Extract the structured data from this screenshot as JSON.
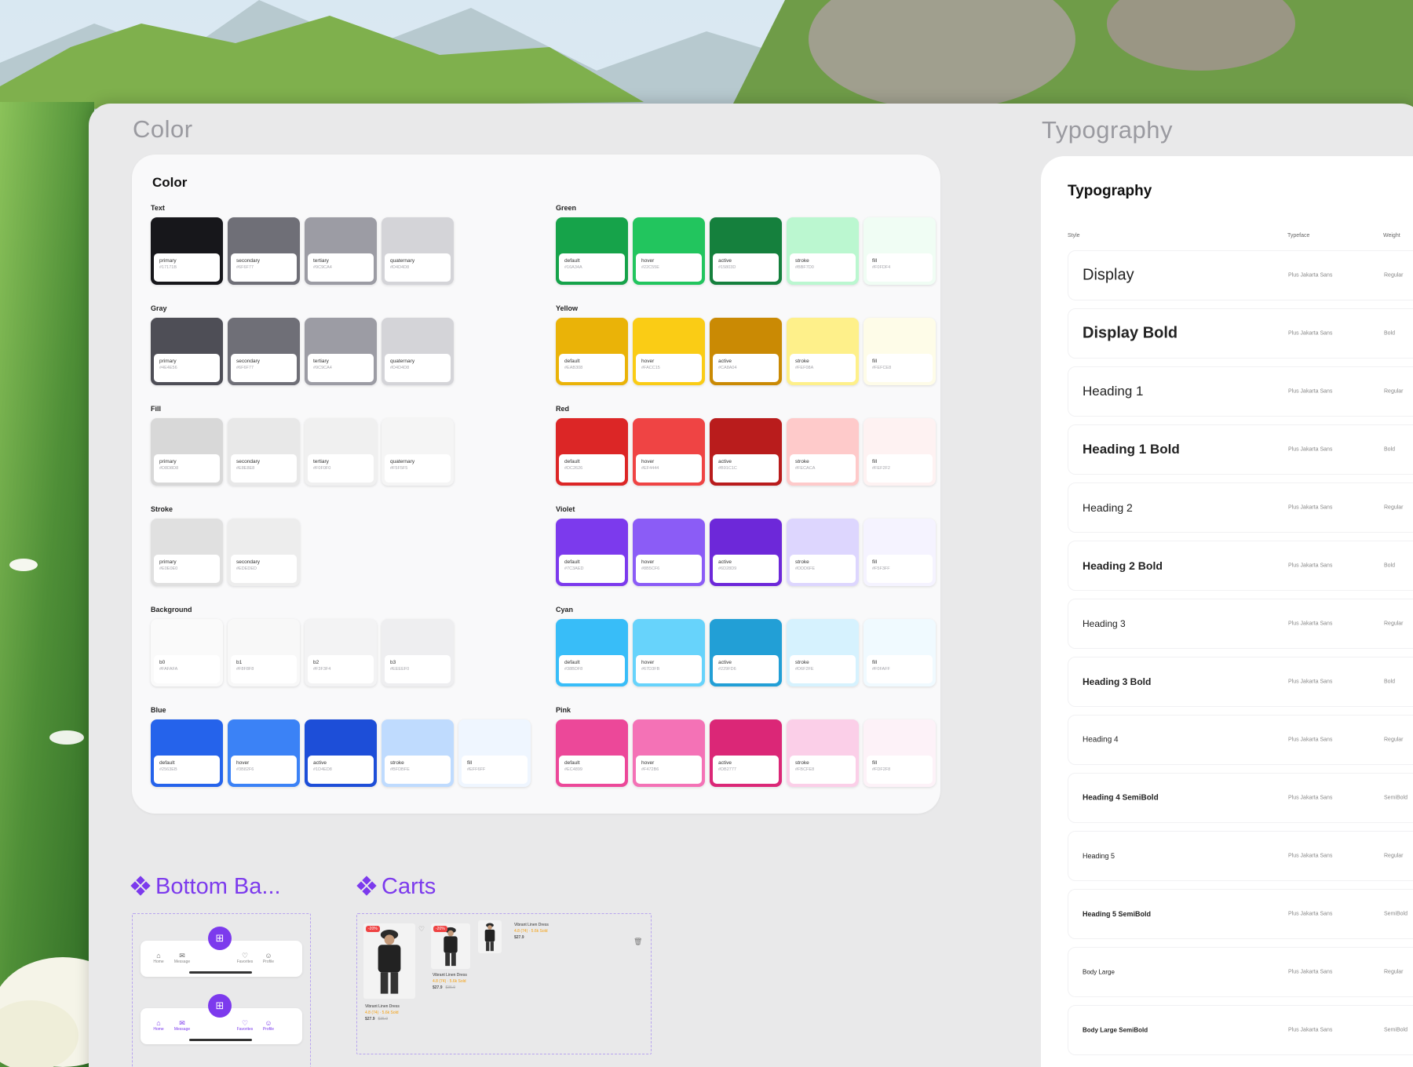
{
  "frames": {
    "color": "Color",
    "typography": "Typography",
    "bottom_bar": "Bottom Ba...",
    "carts": "Carts"
  },
  "color_card": {
    "title": "Color",
    "left_groups": [
      {
        "label": "Text",
        "swatches": [
          {
            "name": "primary",
            "hex": "#17171B",
            "color": "#17171b"
          },
          {
            "name": "secondary",
            "hex": "#6F6F77",
            "color": "#6f6f77"
          },
          {
            "name": "tertiary",
            "hex": "#9C9CA4",
            "color": "#9c9ca4"
          },
          {
            "name": "quaternary",
            "hex": "#D4D4D8",
            "color": "#d4d4d8"
          }
        ]
      },
      {
        "label": "Gray",
        "swatches": [
          {
            "name": "primary",
            "hex": "#4E4E56",
            "color": "#4e4e56"
          },
          {
            "name": "secondary",
            "hex": "#6F6F77",
            "color": "#6f6f77"
          },
          {
            "name": "tertiary",
            "hex": "#9C9CA4",
            "color": "#9c9ca4"
          },
          {
            "name": "quaternary",
            "hex": "#D4D4D8",
            "color": "#d4d4d8"
          }
        ]
      },
      {
        "label": "Fill",
        "swatches": [
          {
            "name": "primary",
            "hex": "#D8D8D8",
            "color": "#d8d8d8"
          },
          {
            "name": "secondary",
            "hex": "#E8E8E8",
            "color": "#e8e8e8"
          },
          {
            "name": "tertiary",
            "hex": "#F0F0F0",
            "color": "#f0f0f0"
          },
          {
            "name": "quaternary",
            "hex": "#F5F5F5",
            "color": "#f5f5f5"
          }
        ]
      },
      {
        "label": "Stroke",
        "swatches": [
          {
            "name": "primary",
            "hex": "#E0E0E0",
            "color": "#e0e0e0"
          },
          {
            "name": "secondary",
            "hex": "#EDEDED",
            "color": "#ededed"
          }
        ]
      },
      {
        "label": "Background",
        "swatches": [
          {
            "name": "b0",
            "hex": "#FAFAFA",
            "color": "#fafafa"
          },
          {
            "name": "b1",
            "hex": "#F8F8F8",
            "color": "#f8f8f8"
          },
          {
            "name": "b2",
            "hex": "#F3F3F4",
            "color": "#f3f3f4"
          },
          {
            "name": "b3",
            "hex": "#EEEEF0",
            "color": "#eeeef0"
          }
        ]
      },
      {
        "label": "Blue",
        "swatches": [
          {
            "name": "default",
            "hex": "#2563EB",
            "color": "#2563eb"
          },
          {
            "name": "hover",
            "hex": "#3B82F6",
            "color": "#3b82f6"
          },
          {
            "name": "active",
            "hex": "#1D4ED8",
            "color": "#1d4ed8"
          },
          {
            "name": "stroke",
            "hex": "#BFDBFE",
            "color": "#bfdbfe"
          },
          {
            "name": "fill",
            "hex": "#EFF6FF",
            "color": "#eff6ff"
          }
        ]
      }
    ],
    "right_groups": [
      {
        "label": "Green",
        "swatches": [
          {
            "name": "default",
            "hex": "#16A34A",
            "color": "#16a34a"
          },
          {
            "name": "hover",
            "hex": "#22C55E",
            "color": "#22c55e"
          },
          {
            "name": "active",
            "hex": "#15803D",
            "color": "#15803d"
          },
          {
            "name": "stroke",
            "hex": "#BBF7D0",
            "color": "#bbf7d0"
          },
          {
            "name": "fill",
            "hex": "#F0FDF4",
            "color": "#f0fdf4"
          }
        ]
      },
      {
        "label": "Yellow",
        "swatches": [
          {
            "name": "default",
            "hex": "#EAB308",
            "color": "#eab308"
          },
          {
            "name": "hover",
            "hex": "#FACC15",
            "color": "#facc15"
          },
          {
            "name": "active",
            "hex": "#CA8A04",
            "color": "#ca8a04"
          },
          {
            "name": "stroke",
            "hex": "#FEF08A",
            "color": "#fef08a"
          },
          {
            "name": "fill",
            "hex": "#FEFCE8",
            "color": "#fefce8"
          }
        ]
      },
      {
        "label": "Red",
        "swatches": [
          {
            "name": "default",
            "hex": "#DC2626",
            "color": "#dc2626"
          },
          {
            "name": "hover",
            "hex": "#EF4444",
            "color": "#ef4444"
          },
          {
            "name": "active",
            "hex": "#B91C1C",
            "color": "#b91c1c"
          },
          {
            "name": "stroke",
            "hex": "#FECACA",
            "color": "#fecaca"
          },
          {
            "name": "fill",
            "hex": "#FEF2F2",
            "color": "#fef2f2"
          }
        ]
      },
      {
        "label": "Violet",
        "swatches": [
          {
            "name": "default",
            "hex": "#7C3AED",
            "color": "#7c3aed"
          },
          {
            "name": "hover",
            "hex": "#8B5CF6",
            "color": "#8b5cf6"
          },
          {
            "name": "active",
            "hex": "#6D28D9",
            "color": "#6d28d9"
          },
          {
            "name": "stroke",
            "hex": "#DDD6FE",
            "color": "#ddd6fe"
          },
          {
            "name": "fill",
            "hex": "#F5F3FF",
            "color": "#f5f3ff"
          }
        ]
      },
      {
        "label": "Cyan",
        "swatches": [
          {
            "name": "default",
            "hex": "#38BDF8",
            "color": "#38bdf8"
          },
          {
            "name": "hover",
            "hex": "#67D3FB",
            "color": "#67d3fb"
          },
          {
            "name": "active",
            "hex": "#229FD6",
            "color": "#229fd6"
          },
          {
            "name": "stroke",
            "hex": "#D6F2FE",
            "color": "#d6f2fe"
          },
          {
            "name": "fill",
            "hex": "#F0FAFF",
            "color": "#f0faff"
          }
        ]
      },
      {
        "label": "Pink",
        "swatches": [
          {
            "name": "default",
            "hex": "#EC4899",
            "color": "#ec4899"
          },
          {
            "name": "hover",
            "hex": "#F472B6",
            "color": "#f472b6"
          },
          {
            "name": "active",
            "hex": "#DB2777",
            "color": "#db2777"
          },
          {
            "name": "stroke",
            "hex": "#FBCFE8",
            "color": "#fbcfe8"
          },
          {
            "name": "fill",
            "hex": "#FDF2F8",
            "color": "#fdf2f8"
          }
        ]
      }
    ]
  },
  "typography": {
    "title": "Typography",
    "col_style": "Style",
    "col_typeface": "Typeface",
    "col_weight": "Weight",
    "rows": [
      {
        "style": "Display",
        "typeface": "Plus Jakarta Sans",
        "weight": "Regular",
        "size": 20,
        "bold": false
      },
      {
        "style": "Display Bold",
        "typeface": "Plus Jakarta Sans",
        "weight": "Bold",
        "size": 20,
        "bold": true
      },
      {
        "style": "Heading 1",
        "typeface": "Plus Jakarta Sans",
        "weight": "Regular",
        "size": 17,
        "bold": false
      },
      {
        "style": "Heading 1 Bold",
        "typeface": "Plus Jakarta Sans",
        "weight": "Bold",
        "size": 17,
        "bold": true
      },
      {
        "style": "Heading 2",
        "typeface": "Plus Jakarta Sans",
        "weight": "Regular",
        "size": 14,
        "bold": false
      },
      {
        "style": "Heading 2 Bold",
        "typeface": "Plus Jakarta Sans",
        "weight": "Bold",
        "size": 14,
        "bold": true
      },
      {
        "style": "Heading 3",
        "typeface": "Plus Jakarta Sans",
        "weight": "Regular",
        "size": 12,
        "bold": false
      },
      {
        "style": "Heading 3 Bold",
        "typeface": "Plus Jakarta Sans",
        "weight": "Bold",
        "size": 12,
        "bold": true
      },
      {
        "style": "Heading 4",
        "typeface": "Plus Jakarta Sans",
        "weight": "Regular",
        "size": 10,
        "bold": false
      },
      {
        "style": "Heading 4 SemiBold",
        "typeface": "Plus Jakarta Sans",
        "weight": "SemiBold",
        "size": 10,
        "bold": true
      },
      {
        "style": "Heading 5",
        "typeface": "Plus Jakarta Sans",
        "weight": "Regular",
        "size": 9,
        "bold": false
      },
      {
        "style": "Heading 5 SemiBold",
        "typeface": "Plus Jakarta Sans",
        "weight": "SemiBold",
        "size": 9,
        "bold": true
      },
      {
        "style": "Body Large",
        "typeface": "Plus Jakarta Sans",
        "weight": "Regular",
        "size": 8,
        "bold": false
      },
      {
        "style": "Body Large SemiBold",
        "typeface": "Plus Jakarta Sans",
        "weight": "SemiBold",
        "size": 8,
        "bold": true
      }
    ]
  },
  "bottom_bar": {
    "fab_icon": "cart-icon",
    "items": [
      {
        "label": "Home",
        "icon": "home-icon"
      },
      {
        "label": "Message",
        "icon": "message-icon"
      },
      {
        "label": "Favorites",
        "icon": "heart-icon"
      },
      {
        "label": "Profile",
        "icon": "user-icon"
      }
    ]
  },
  "carts": {
    "items": [
      {
        "badge": "-20%",
        "name": "Vibrant Linen Dress",
        "rating": "4.8 (74) · 5.6k Sold",
        "price": "$27.9",
        "old": "$35.9"
      },
      {
        "badge": "-20%",
        "name": "Vibrant Linen Dress",
        "rating": "4.8 (74) · 5.6k Sold",
        "price": "$27.9",
        "old": "$35.9"
      },
      {
        "badge": "",
        "name": "Vibrant Linen Dress",
        "rating": "4.8 (74) · 5.6k Sold",
        "price": "$27.9",
        "old": ""
      }
    ]
  }
}
